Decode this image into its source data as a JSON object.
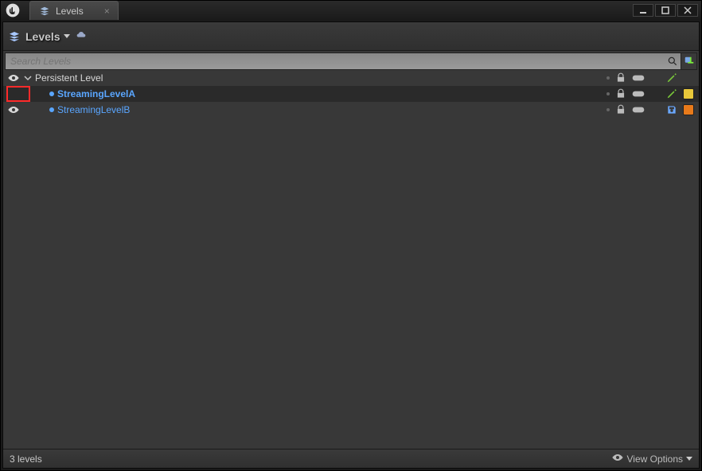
{
  "window": {
    "tab_title": "Levels"
  },
  "toolbar": {
    "levels_label": "Levels"
  },
  "search": {
    "placeholder": "Search Levels"
  },
  "rows": {
    "persistent": {
      "name": "Persistent Level"
    },
    "a": {
      "name": "StreamingLevelA"
    },
    "b": {
      "name": "StreamingLevelB"
    }
  },
  "status": {
    "count": "3 levels",
    "view_options": "View Options"
  }
}
